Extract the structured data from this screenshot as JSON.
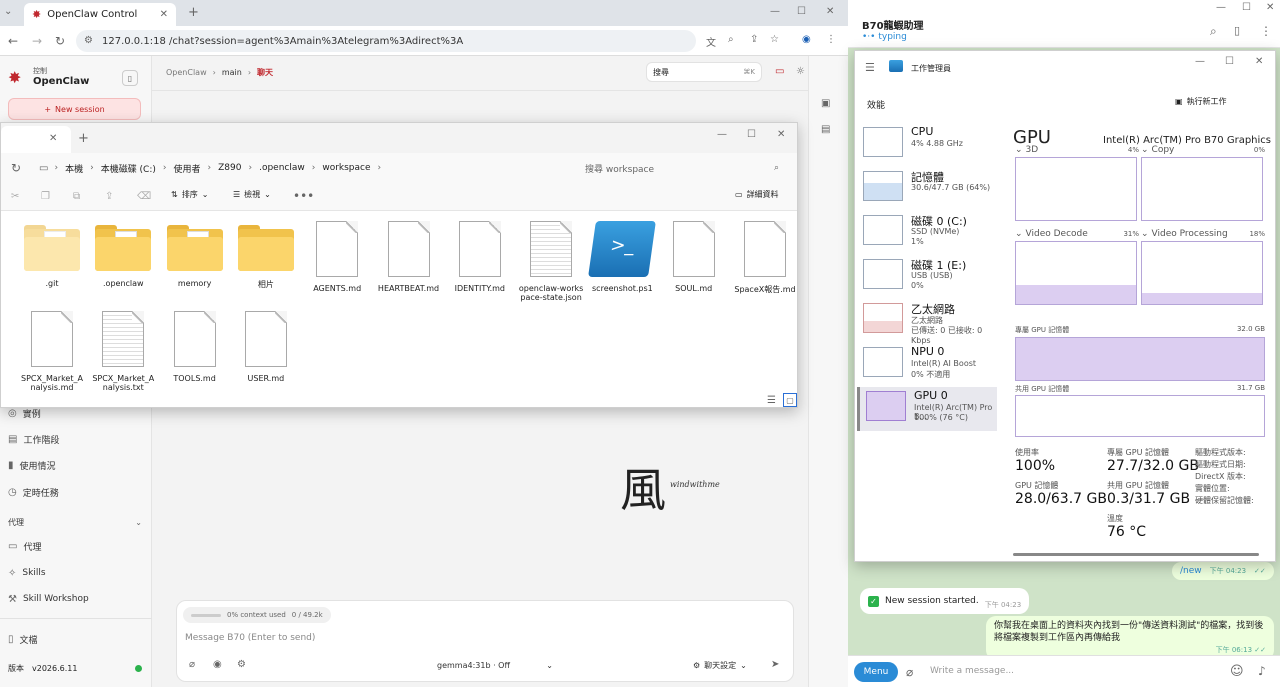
{
  "browser": {
    "tab_title": "OpenClaw Control",
    "url": "127.0.0.1:18     /chat?session=agent%3Amain%3Atelegram%3Adirect%3A"
  },
  "openclaw": {
    "logo_top": "控制",
    "logo_name": "OpenClaw",
    "new_session": "New session",
    "breadcrumb": [
      "OpenClaw",
      "main",
      "聊天"
    ],
    "search_label": "搜尋",
    "search_shortcut": "⌘K",
    "nav_lower": [
      {
        "label": "實例",
        "icon": "broadcast-icon"
      },
      {
        "label": "工作階段",
        "icon": "file-icon"
      },
      {
        "label": "使用情況",
        "icon": "bar-chart-icon"
      },
      {
        "label": "定時任務",
        "icon": "clock-icon"
      }
    ],
    "section_agent": "代理",
    "nav_agent": [
      {
        "label": "代理",
        "icon": "folder-icon"
      },
      {
        "label": "Skills",
        "icon": "sparkle-icon"
      },
      {
        "label": "Skill Workshop",
        "icon": "wrench-icon"
      }
    ],
    "docs_label": "文檔",
    "version_label": "版本",
    "version_value": "v2026.6.11",
    "context_used": "0% context used",
    "context_tokens": "0 / 49.2k",
    "message_placeholder": "Message B70 (Enter to send)",
    "model": "gemma4:31b · Off",
    "chat_settings": "聊天設定",
    "watermark_char": "風",
    "watermark_text": "windwithme"
  },
  "explorer": {
    "breadcrumb": [
      "本機",
      "本機磁碟 (C:)",
      "使用者",
      "Z890",
      ".openclaw",
      "workspace"
    ],
    "search_placeholder": "搜尋 workspace",
    "sort_label": "排序",
    "view_label": "檢視",
    "details_label": "詳細資料",
    "items": [
      {
        "name": ".git",
        "type": "folder-faded"
      },
      {
        "name": ".openclaw",
        "type": "folder"
      },
      {
        "name": "memory",
        "type": "folder"
      },
      {
        "name": "相片",
        "type": "folder-plain"
      },
      {
        "name": "AGENTS.md",
        "type": "doc"
      },
      {
        "name": "HEARTBEAT.md",
        "type": "doc"
      },
      {
        "name": "IDENTITY.md",
        "type": "doc"
      },
      {
        "name": "openclaw-workspace-state.json",
        "type": "doc-lines"
      },
      {
        "name": "screenshot.ps1",
        "type": "ps"
      },
      {
        "name": "SOUL.md",
        "type": "doc"
      },
      {
        "name": "SpaceX報告.md",
        "type": "doc"
      },
      {
        "name": "SPCX_Market_Analysis.md",
        "type": "doc"
      },
      {
        "name": "SPCX_Market_Analysis.txt",
        "type": "doc-lines"
      },
      {
        "name": "TOOLS.md",
        "type": "doc"
      },
      {
        "name": "USER.md",
        "type": "doc"
      }
    ]
  },
  "telegram": {
    "chat_name": "B70龍蝦助理",
    "status": "typing",
    "msg_new": "/new",
    "msg_new_time": "下午 04:23",
    "msg_started": "New session started.",
    "msg_started_time": "下午 04:23",
    "msg_request": "你幫我在桌面上的資料夾內找到一份\"傳送資料測試\"的檔案，找到後將檔案複製到工作區內再傳給我",
    "msg_request_time": "下午 06:13",
    "menu_label": "Menu",
    "input_placeholder": "Write a message..."
  },
  "taskmgr": {
    "title": "工作管理員",
    "section": "效能",
    "run_task": "執行新工作",
    "items": [
      {
        "name": "CPU",
        "sub1": "4% 4.88 GHz",
        "sub2": ""
      },
      {
        "name": "記憶體",
        "sub1": "30.6/47.7 GB (64%)",
        "sub2": ""
      },
      {
        "name": "磁碟 0 (C:)",
        "sub1": "SSD (NVMe)",
        "sub2": "1%"
      },
      {
        "name": "磁碟 1 (E:)",
        "sub1": "USB (USB)",
        "sub2": "0%"
      },
      {
        "name": "乙太網路",
        "sub1": "乙太網路",
        "sub2": "已傳送: 0 已接收: 0 Kbps"
      },
      {
        "name": "NPU 0",
        "sub1": "Intel(R) AI Boost",
        "sub2": "0% 不適用"
      },
      {
        "name": "GPU 0",
        "sub1": "Intel(R) Arc(TM) Pro B...",
        "sub2": "100% (76 °C)"
      }
    ],
    "gpu_title": "GPU",
    "gpu_name": "Intel(R) Arc(TM) Pro B70 Graphics",
    "engines": [
      {
        "name": "3D",
        "pct": "4%"
      },
      {
        "name": "Copy",
        "pct": "0%"
      },
      {
        "name": "Video Decode",
        "pct": "31%"
      },
      {
        "name": "Video Processing",
        "pct": "18%"
      }
    ],
    "dedicated_label": "專屬 GPU 記憶體",
    "dedicated_max": "32.0 GB",
    "shared_label": "共用 GPU 記憶體",
    "shared_max": "31.7 GB",
    "stats": {
      "util_label": "使用率",
      "util_value": "100%",
      "ded_label": "專屬 GPU 記憶體",
      "ded_value": "27.7/32.0 GB",
      "gpumem_label": "GPU 記憶體",
      "gpumem_value": "28.0/63.7 GB",
      "shared_label": "共用 GPU 記憶體",
      "shared_value": "0.3/31.7 GB",
      "temp_label": "溫度",
      "temp_value": "76 °C",
      "driver_ver": "驅動程式版本:",
      "driver_date": "驅動程式日期:",
      "directx": "DirectX 版本:",
      "location": "實體位置:",
      "reserved": "硬體保留記憶體:"
    }
  }
}
